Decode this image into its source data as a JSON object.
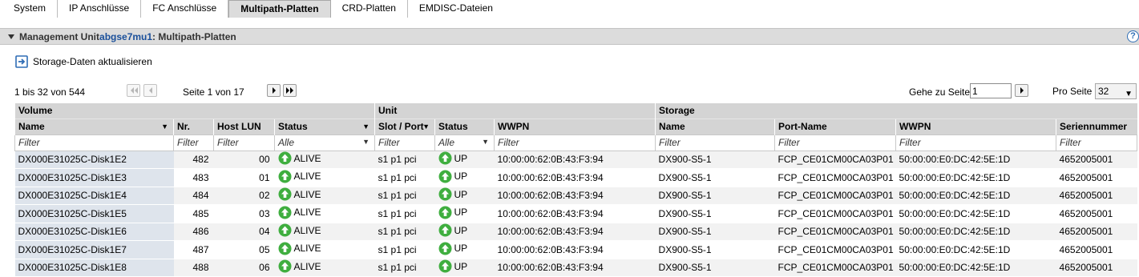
{
  "tabs": [
    "System",
    "IP Anschlüsse",
    "FC Anschlüsse",
    "Multipath-Platten",
    "CRD-Platten",
    "EMDISC-Dateien"
  ],
  "active_tab": "Multipath-Platten",
  "panel": {
    "prefix": "Management Unit ",
    "unit_name": "abgse7mu1",
    "suffix": ": Multipath-Platten",
    "help": "?"
  },
  "actions": {
    "refresh_label": "Storage-Daten aktualisieren"
  },
  "pager": {
    "count": "1 bis 32 von 544",
    "page_info": "Seite 1 von 17",
    "goto_label": "Gehe zu Seite",
    "goto_value": "1",
    "perpage_label": "Pro Seite",
    "perpage_value": "32"
  },
  "table": {
    "groups": [
      "Volume",
      "Unit",
      "Storage"
    ],
    "columns": [
      "Name",
      "Nr.",
      "Host LUN",
      "Status",
      "Slot / Port",
      "Status",
      "WWPN",
      "Name",
      "Port-Name",
      "WWPN",
      "Seriennummer"
    ],
    "filters": [
      "Filter",
      "Filter",
      "Filter",
      "Alle",
      "Filter",
      "Alle",
      "Filter",
      "Filter",
      "Filter",
      "Filter",
      "Filter"
    ],
    "rows": [
      [
        "DX000E31025C-Disk1E2",
        "482",
        "00",
        "ALIVE",
        "s1 p1 pci",
        "UP",
        "10:00:00:62:0B:43:F3:94",
        "DX900-S5-1",
        "FCP_CE01CM00CA03P01",
        "50:00:00:E0:DC:42:5E:1D",
        "4652005001"
      ],
      [
        "DX000E31025C-Disk1E3",
        "483",
        "01",
        "ALIVE",
        "s1 p1 pci",
        "UP",
        "10:00:00:62:0B:43:F3:94",
        "DX900-S5-1",
        "FCP_CE01CM00CA03P01",
        "50:00:00:E0:DC:42:5E:1D",
        "4652005001"
      ],
      [
        "DX000E31025C-Disk1E4",
        "484",
        "02",
        "ALIVE",
        "s1 p1 pci",
        "UP",
        "10:00:00:62:0B:43:F3:94",
        "DX900-S5-1",
        "FCP_CE01CM00CA03P01",
        "50:00:00:E0:DC:42:5E:1D",
        "4652005001"
      ],
      [
        "DX000E31025C-Disk1E5",
        "485",
        "03",
        "ALIVE",
        "s1 p1 pci",
        "UP",
        "10:00:00:62:0B:43:F3:94",
        "DX900-S5-1",
        "FCP_CE01CM00CA03P01",
        "50:00:00:E0:DC:42:5E:1D",
        "4652005001"
      ],
      [
        "DX000E31025C-Disk1E6",
        "486",
        "04",
        "ALIVE",
        "s1 p1 pci",
        "UP",
        "10:00:00:62:0B:43:F3:94",
        "DX900-S5-1",
        "FCP_CE01CM00CA03P01",
        "50:00:00:E0:DC:42:5E:1D",
        "4652005001"
      ],
      [
        "DX000E31025C-Disk1E7",
        "487",
        "05",
        "ALIVE",
        "s1 p1 pci",
        "UP",
        "10:00:00:62:0B:43:F3:94",
        "DX900-S5-1",
        "FCP_CE01CM00CA03P01",
        "50:00:00:E0:DC:42:5E:1D",
        "4652005001"
      ],
      [
        "DX000E31025C-Disk1E8",
        "488",
        "06",
        "ALIVE",
        "s1 p1 pci",
        "UP",
        "10:00:00:62:0B:43:F3:94",
        "DX900-S5-1",
        "FCP_CE01CM00CA03P01",
        "50:00:00:E0:DC:42:5E:1D",
        "4652005001"
      ]
    ]
  },
  "colors": {
    "status_ok": "#3fae3f",
    "link": "#1a4f9a",
    "header_bg": "#d4d4d4"
  },
  "icons": {
    "status": "up-arrow-circle-icon",
    "refresh": "refresh-icon",
    "expand": "triangle-down-icon",
    "help": "help-icon"
  }
}
